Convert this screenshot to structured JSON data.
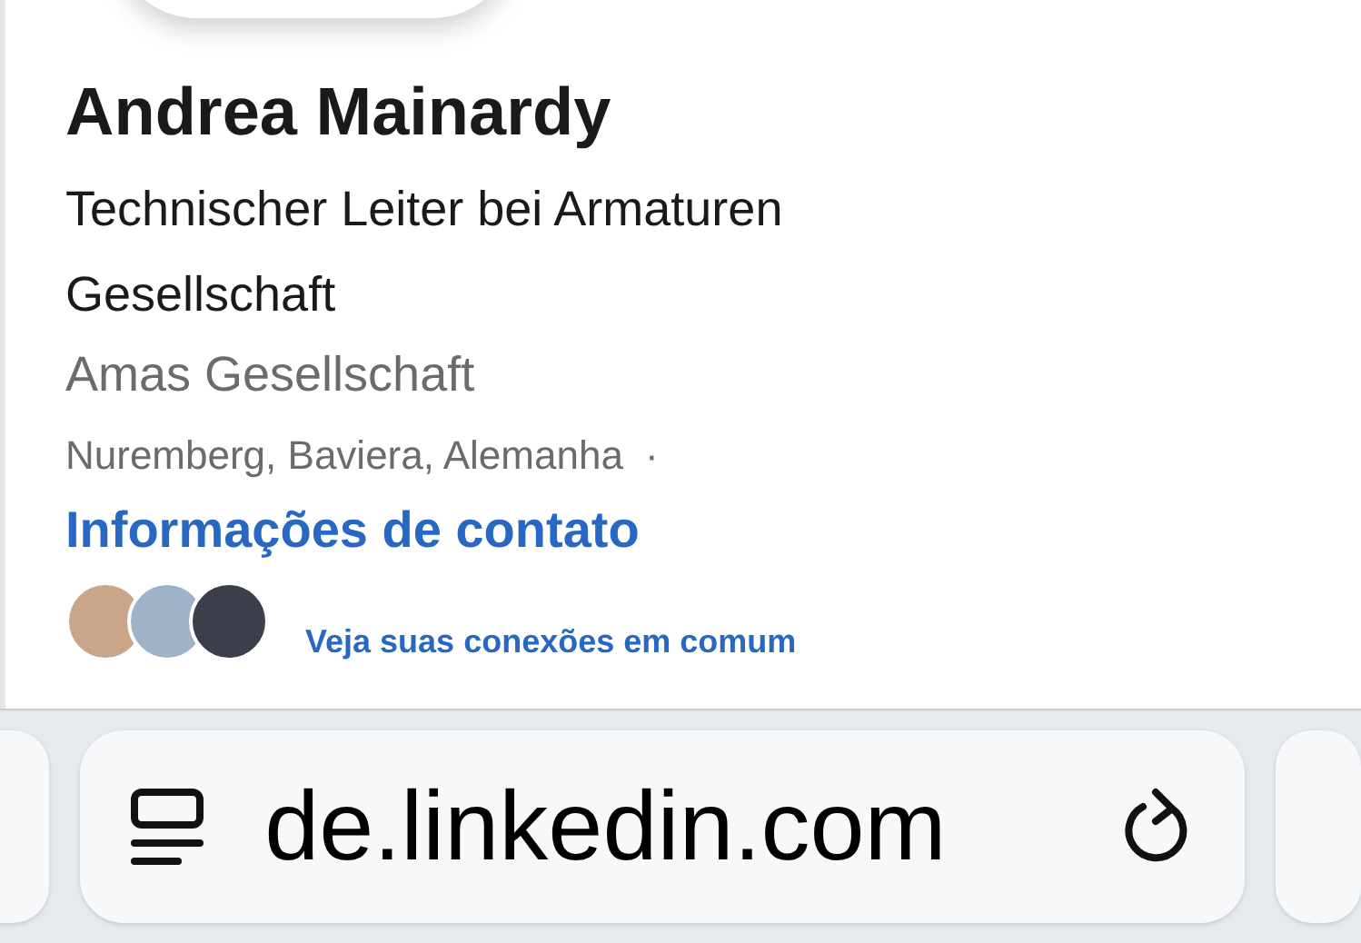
{
  "profile": {
    "name": "Andrea Mainardy",
    "headline": "Technischer Leiter bei Armaturen Gesellschaft",
    "company": "Amas Gesellschaft",
    "location": "Nuremberg, Baviera, Alemanha",
    "separator": "·",
    "contact_link": "Informações de contato",
    "mutual_connections_link": "Veja suas conexões em comum"
  },
  "address_bar": {
    "url": "de.linkedin.com"
  }
}
